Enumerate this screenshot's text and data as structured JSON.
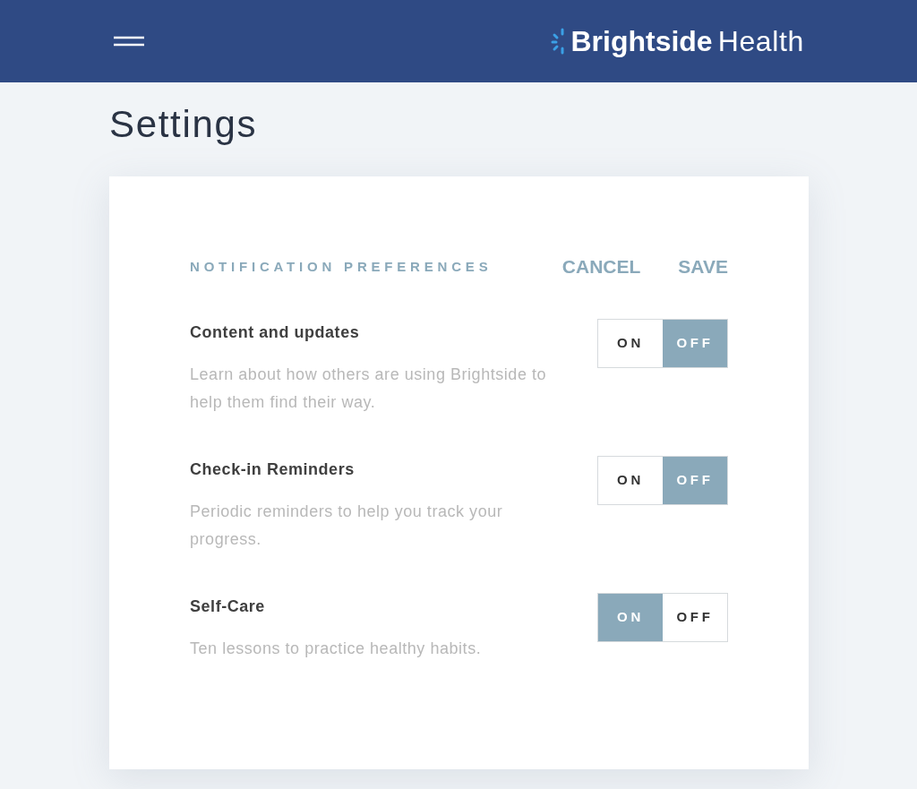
{
  "header": {
    "logo": {
      "bold": "Brightside",
      "regular": "Health"
    }
  },
  "page": {
    "title": "Settings"
  },
  "card": {
    "heading": "NOTIFICATION PREFERENCES",
    "actions": [
      {
        "label": "CANCEL"
      },
      {
        "label": "SAVE"
      }
    ]
  },
  "preferences": [
    {
      "title": "Content and updates",
      "description": "Learn about how others are using Brightside to help them find their way.",
      "options": [
        {
          "label": "ON",
          "selected": false
        },
        {
          "label": "OFF",
          "selected": true
        }
      ]
    },
    {
      "title": "Check-in Reminders",
      "description": "Periodic reminders to help you track your progress.",
      "options": [
        {
          "label": "ON",
          "selected": false
        },
        {
          "label": "OFF",
          "selected": true
        }
      ]
    },
    {
      "title": "Self-Care",
      "description": "Ten lessons to practice healthy habits.",
      "options": [
        {
          "label": "ON",
          "selected": true
        },
        {
          "label": "OFF",
          "selected": false
        }
      ]
    }
  ]
}
